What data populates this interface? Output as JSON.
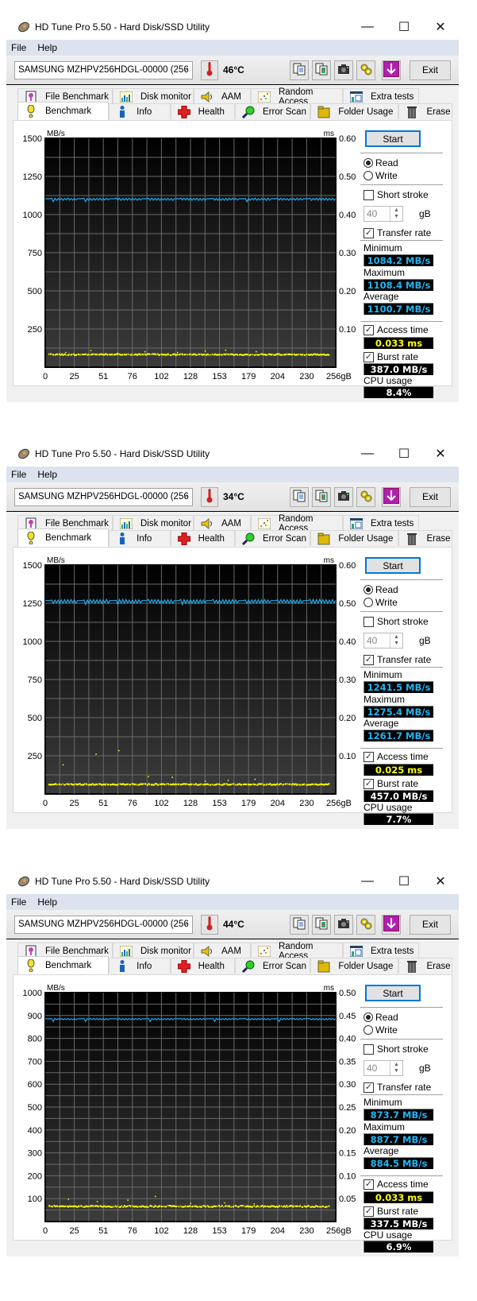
{
  "windows": [
    {
      "title": "HD Tune Pro 5.50 - Hard Disk/SSD Utility",
      "menu": [
        "File",
        "Help"
      ],
      "drive": "SAMSUNG MZHPV256HDGL-00000 (256",
      "temperature": "46°C",
      "toolbar_icons": [
        "copy-text-icon",
        "copy-image-icon",
        "screenshot-camera-icon",
        "options-gears-icon",
        "save-download-icon"
      ],
      "exit_label": "Exit",
      "tabs_row1": [
        "File Benchmark",
        "Disk monitor",
        "AAM",
        "Random Access",
        "Extra tests"
      ],
      "tabs_row2": [
        "Benchmark",
        "Info",
        "Health",
        "Error Scan",
        "Folder Usage",
        "Erase"
      ],
      "active_tab": "Benchmark",
      "panel": {
        "start_label": "Start",
        "read_label": "Read",
        "write_label": "Write",
        "mode": "Read",
        "short_stroke_label": "Short stroke",
        "short_stroke_checked": false,
        "short_stroke_value": "40",
        "short_stroke_unit": "gB",
        "transfer_rate_label": "Transfer rate",
        "transfer_rate_checked": true,
        "minimum_label": "Minimum",
        "minimum": "1084.2 MB/s",
        "maximum_label": "Maximum",
        "maximum": "1108.4 MB/s",
        "average_label": "Average",
        "average": "1100.7 MB/s",
        "access_time_label": "Access time",
        "access_time_checked": true,
        "access_time": "0.033 ms",
        "burst_rate_label": "Burst rate",
        "burst_rate_checked": true,
        "burst_rate": "387.0 MB/s",
        "cpu_usage_label": "CPU usage",
        "cpu_usage": "8.4%"
      }
    },
    {
      "title": "HD Tune Pro 5.50 - Hard Disk/SSD Utility",
      "menu": [
        "File",
        "Help"
      ],
      "drive": "SAMSUNG MZHPV256HDGL-00000 (256",
      "temperature": "34°C",
      "toolbar_icons": [
        "copy-text-icon",
        "copy-image-icon",
        "screenshot-camera-icon",
        "options-gears-icon",
        "save-download-icon"
      ],
      "exit_label": "Exit",
      "tabs_row1": [
        "File Benchmark",
        "Disk monitor",
        "AAM",
        "Random Access",
        "Extra tests"
      ],
      "tabs_row2": [
        "Benchmark",
        "Info",
        "Health",
        "Error Scan",
        "Folder Usage",
        "Erase"
      ],
      "active_tab": "Benchmark",
      "panel": {
        "start_label": "Start",
        "read_label": "Read",
        "write_label": "Write",
        "mode": "Read",
        "short_stroke_label": "Short stroke",
        "short_stroke_checked": false,
        "short_stroke_value": "40",
        "short_stroke_unit": "gB",
        "transfer_rate_label": "Transfer rate",
        "transfer_rate_checked": true,
        "minimum_label": "Minimum",
        "minimum": "1241.5 MB/s",
        "maximum_label": "Maximum",
        "maximum": "1275.4 MB/s",
        "average_label": "Average",
        "average": "1261.7 MB/s",
        "access_time_label": "Access time",
        "access_time_checked": true,
        "access_time": "0.025 ms",
        "burst_rate_label": "Burst rate",
        "burst_rate_checked": true,
        "burst_rate": "457.0 MB/s",
        "cpu_usage_label": "CPU usage",
        "cpu_usage": "7.7%"
      }
    },
    {
      "title": "HD Tune Pro 5.50 - Hard Disk/SSD Utility",
      "menu": [
        "File",
        "Help"
      ],
      "drive": "SAMSUNG MZHPV256HDGL-00000 (256",
      "temperature": "44°C",
      "toolbar_icons": [
        "copy-text-icon",
        "copy-image-icon",
        "screenshot-camera-icon",
        "options-gears-icon",
        "save-download-icon"
      ],
      "exit_label": "Exit",
      "tabs_row1": [
        "File Benchmark",
        "Disk monitor",
        "AAM",
        "Random Access",
        "Extra tests"
      ],
      "tabs_row2": [
        "Benchmark",
        "Info",
        "Health",
        "Error Scan",
        "Folder Usage",
        "Erase"
      ],
      "active_tab": "Benchmark",
      "panel": {
        "start_label": "Start",
        "read_label": "Read",
        "write_label": "Write",
        "mode": "Read",
        "short_stroke_label": "Short stroke",
        "short_stroke_checked": false,
        "short_stroke_value": "40",
        "short_stroke_unit": "gB",
        "transfer_rate_label": "Transfer rate",
        "transfer_rate_checked": true,
        "minimum_label": "Minimum",
        "minimum": "873.7 MB/s",
        "maximum_label": "Maximum",
        "maximum": "887.7 MB/s",
        "average_label": "Average",
        "average": "884.5 MB/s",
        "access_time_label": "Access time",
        "access_time_checked": true,
        "access_time": "0.033 ms",
        "burst_rate_label": "Burst rate",
        "burst_rate_checked": true,
        "burst_rate": "337.5 MB/s",
        "cpu_usage_label": "CPU usage",
        "cpu_usage": "6.9%"
      }
    }
  ],
  "chart_data": [
    {
      "type": "line",
      "title": "",
      "ylabel": "MB/s",
      "y2label": "ms",
      "xlabel": "gB",
      "ylim": [
        0,
        1500
      ],
      "y2lim": [
        0,
        0.6
      ],
      "xlim": [
        0,
        256
      ],
      "yticks": [
        250,
        500,
        750,
        1000,
        1250,
        1500
      ],
      "y2ticks": [
        "0.10",
        "0.20",
        "0.30",
        "0.40",
        "0.50",
        "0.60"
      ],
      "xticks": [
        "0",
        "25",
        "51",
        "76",
        "102",
        "128",
        "153",
        "179",
        "204",
        "230",
        "256gB"
      ],
      "grid": true,
      "series": [
        {
          "name": "Transfer rate",
          "color": "#1fa8e8",
          "mean": 1100.7,
          "min": 1084.2,
          "max": 1108.4
        },
        {
          "name": "Access time",
          "color": "#ffff00",
          "axis": "y2",
          "mean_ms": 0.033,
          "outliers_ms": [
            0.04,
            0.045,
            0.038,
            0.042,
            0.04,
            0.044,
            0.046,
            0.042
          ]
        }
      ]
    },
    {
      "type": "line",
      "title": "",
      "ylabel": "MB/s",
      "y2label": "ms",
      "xlabel": "gB",
      "ylim": [
        0,
        1500
      ],
      "y2lim": [
        0,
        0.6
      ],
      "xlim": [
        0,
        256
      ],
      "yticks": [
        250,
        500,
        750,
        1000,
        1250,
        1500
      ],
      "y2ticks": [
        "0.10",
        "0.20",
        "0.30",
        "0.40",
        "0.50",
        "0.60"
      ],
      "xticks": [
        "0",
        "25",
        "51",
        "76",
        "102",
        "128",
        "153",
        "179",
        "204",
        "230",
        "256gB"
      ],
      "grid": true,
      "series": [
        {
          "name": "Transfer rate",
          "color": "#1fa8e8",
          "mean": 1261.7,
          "min": 1241.5,
          "max": 1275.4
        },
        {
          "name": "Access time",
          "color": "#ffff00",
          "axis": "y2",
          "mean_ms": 0.025,
          "outliers_ms": [
            0.078,
            0.106,
            0.115,
            0.047,
            0.045,
            0.035,
            0.037,
            0.04
          ]
        }
      ]
    },
    {
      "type": "line",
      "title": "",
      "ylabel": "MB/s",
      "y2label": "ms",
      "xlabel": "gB",
      "ylim": [
        0,
        1000
      ],
      "y2lim": [
        0,
        0.5
      ],
      "xlim": [
        0,
        256
      ],
      "yticks": [
        100,
        200,
        300,
        400,
        500,
        600,
        700,
        800,
        900,
        1000
      ],
      "y2ticks": [
        "0.05",
        "0.10",
        "0.15",
        "0.20",
        "0.25",
        "0.30",
        "0.35",
        "0.40",
        "0.45",
        "0.50"
      ],
      "xticks": [
        "0",
        "25",
        "51",
        "76",
        "102",
        "128",
        "153",
        "179",
        "204",
        "230",
        "256gB"
      ],
      "grid": true,
      "series": [
        {
          "name": "Transfer rate",
          "color": "#1fa8e8",
          "mean": 884.5,
          "min": 873.7,
          "max": 887.7
        },
        {
          "name": "Access time",
          "color": "#ffff00",
          "axis": "y2",
          "mean_ms": 0.033,
          "outliers_ms": [
            0.05,
            0.045,
            0.048,
            0.056,
            0.041,
            0.042,
            0.04
          ]
        }
      ]
    }
  ]
}
